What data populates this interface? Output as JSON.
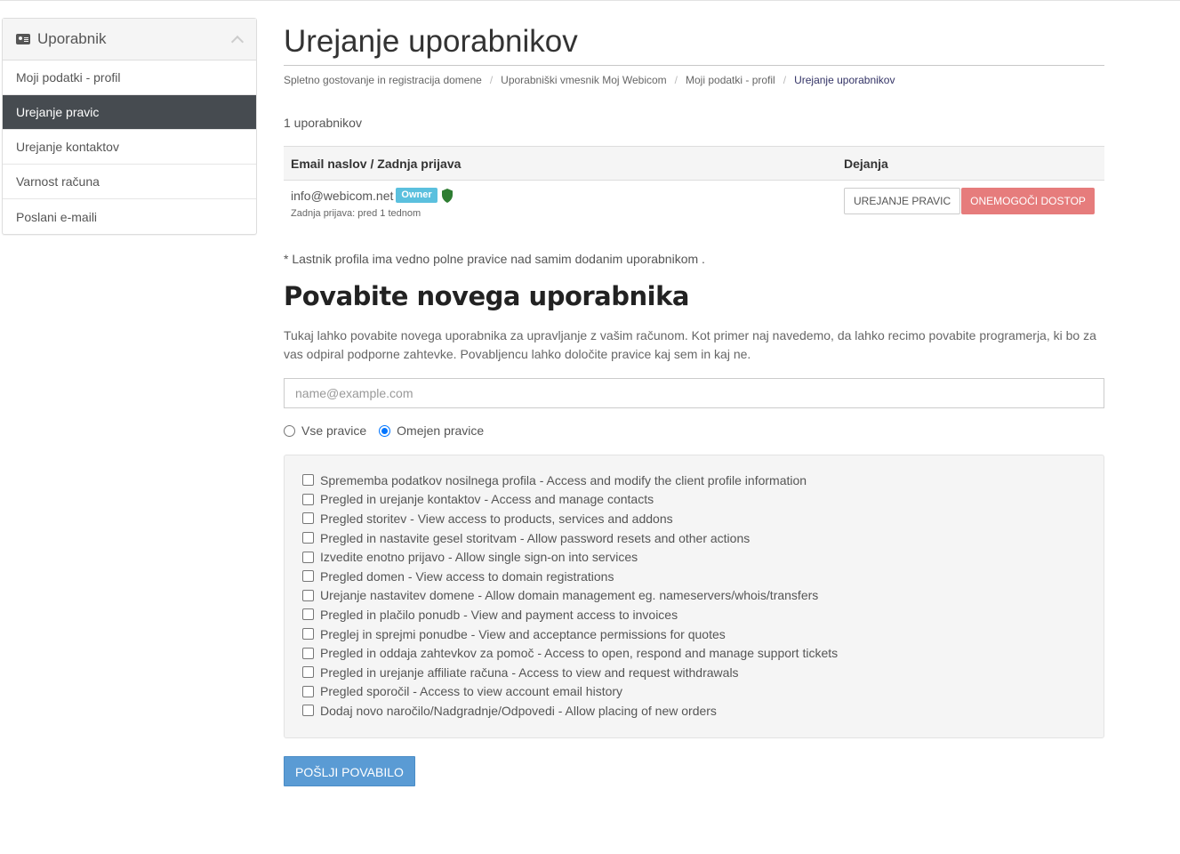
{
  "sidebar": {
    "title": "Uporabnik",
    "items": [
      {
        "label": "Moji podatki - profil"
      },
      {
        "label": "Urejanje pravic"
      },
      {
        "label": "Urejanje kontaktov"
      },
      {
        "label": "Varnost računa"
      },
      {
        "label": "Poslani e-maili"
      }
    ],
    "active_index": 1
  },
  "header": {
    "title": "Urejanje uporabnikov",
    "breadcrumb": [
      "Spletno gostovanje in registracija domene",
      "Uporabniški vmesnik Moj Webicom",
      "Moji podatki - profil",
      "Urejanje uporabnikov"
    ]
  },
  "users": {
    "count_text": "1 uporabnikov",
    "columns": [
      "Email naslov / Zadnja prijava",
      "Dejanja"
    ],
    "rows": [
      {
        "email": "info@webicom.net",
        "badge": "Owner",
        "last_login": "Zadnja prijava: pred 1 tednom",
        "edit_label": "UREJANJE PRAVIC",
        "disable_label": "ONEMOGOČI DOSTOP"
      }
    ]
  },
  "note": "* Lastnik profila ima vedno polne pravice nad samim dodanim uporabnikom .",
  "invite": {
    "title": "Povabite novega uporabnika",
    "description": "Tukaj lahko povabite novega uporabnika za upravljanje z vašim računom. Kot primer naj navedemo, da lahko recimo povabite programerja, ki bo za vas odpiral podporne zahtevke. Povabljencu lahko določite pravice kaj sem in kaj ne.",
    "email_placeholder": "name@example.com",
    "email_value": "",
    "radio_all": "Vse pravice",
    "radio_limited": "Omejen pravice",
    "selected": "limited",
    "permissions": [
      "Sprememba podatkov nosilnega profila - Access and modify the client profile information",
      "Pregled in urejanje kontaktov - Access and manage contacts",
      "Pregled storitev - View access to products, services and addons",
      "Pregled in nastavite gesel storitvam - Allow password resets and other actions",
      "Izvedite enotno prijavo - Allow single sign-on into services",
      "Pregled domen - View access to domain registrations",
      "Urejanje nastavitev domene - Allow domain management eg. nameservers/whois/transfers",
      "Pregled in plačilo ponudb - View and payment access to invoices",
      "Preglej in sprejmi ponudbe - View and acceptance permissions for quotes",
      "Pregled in oddaja zahtevkov za pomoč - Access to open, respond and manage support tickets",
      "Pregled in urejanje affiliate računa - Access to view and request withdrawals",
      "Pregled sporočil - Access to view account email history",
      "Dodaj novo naročilo/Nadgradnje/Odpovedi - Allow placing of new orders"
    ],
    "send_label": "POŠLJI POVABILO"
  },
  "colors": {
    "active_nav": "#464b50",
    "badge": "#5bc0de",
    "danger_button": "#e67c7c",
    "primary_button": "#5a9bd4",
    "shield": "#2e7d32"
  },
  "icons": {
    "sidebar_header": "id-card-icon",
    "collapse": "chevron-up-icon",
    "owner": "shield-icon"
  }
}
